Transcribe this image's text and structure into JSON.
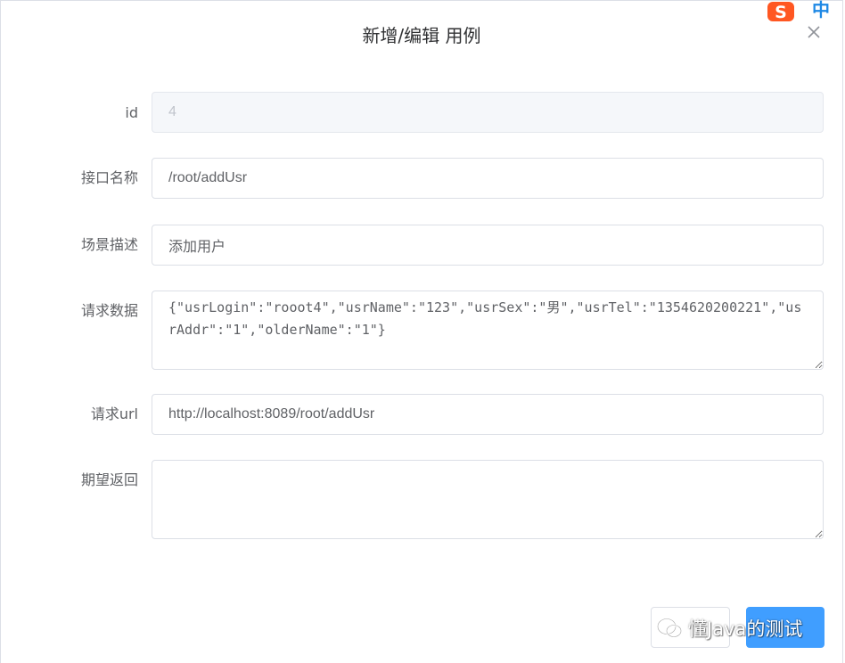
{
  "dialog": {
    "title": "新增/编辑 用例",
    "close_icon": "close-icon"
  },
  "ime": {
    "brand_letter": "S",
    "mode": "中",
    "brand_color": "#ff5722",
    "mode_color": "#1e88e5"
  },
  "form": {
    "id": {
      "label": "id",
      "value": "4"
    },
    "api_name": {
      "label": "接口名称",
      "value": "/root/addUsr"
    },
    "scene": {
      "label": "场景描述",
      "value": "添加用户"
    },
    "request_data": {
      "label": "请求数据",
      "value": "{\"usrLogin\":\"rooot4\",\"usrName\":\"123\",\"usrSex\":\"男\",\"usrTel\":\"1354620200221\",\"usrAddr\":\"1\",\"olderName\":\"1\"}"
    },
    "request_url": {
      "label": "请求url",
      "value": "http://localhost:8089/root/addUsr"
    },
    "expected": {
      "label": "期望返回",
      "value": ""
    }
  },
  "footer": {
    "cancel_label": "",
    "confirm_label": ""
  },
  "watermark": {
    "text": "懂Java的测试",
    "icon": "wechat-icon"
  },
  "colors": {
    "primary": "#409eff",
    "border": "#dcdfe6",
    "disabled_bg": "#f5f7fa",
    "text": "#606266",
    "title": "#303133"
  }
}
